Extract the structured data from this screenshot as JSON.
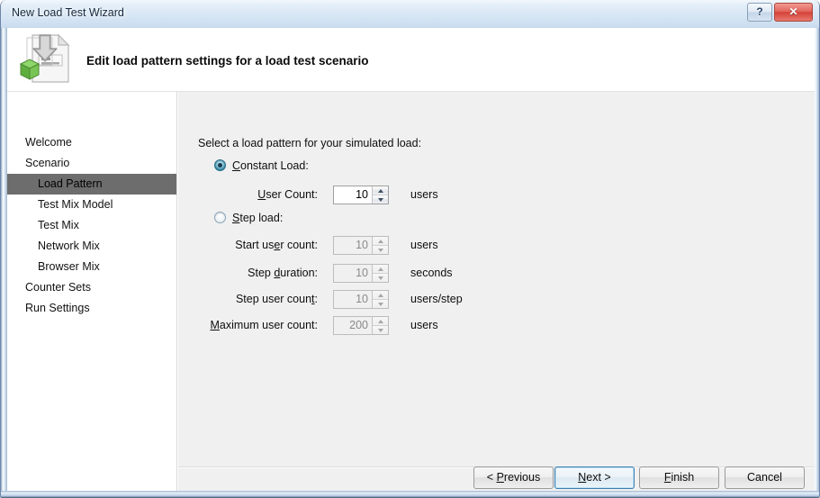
{
  "window": {
    "title": "New Load Test Wizard",
    "help_label": "?",
    "close_label": "✕"
  },
  "banner": {
    "icon": "load-test-document-icon",
    "title": "Edit load pattern settings for a load test scenario"
  },
  "sidebar": {
    "items": [
      {
        "label": "Welcome",
        "level": 0,
        "selected": false
      },
      {
        "label": "Scenario",
        "level": 0,
        "selected": false
      },
      {
        "label": "Load Pattern",
        "level": 1,
        "selected": true
      },
      {
        "label": "Test Mix Model",
        "level": 1,
        "selected": false
      },
      {
        "label": "Test Mix",
        "level": 1,
        "selected": false
      },
      {
        "label": "Network Mix",
        "level": 1,
        "selected": false
      },
      {
        "label": "Browser Mix",
        "level": 1,
        "selected": false
      },
      {
        "label": "Counter Sets",
        "level": 0,
        "selected": false
      },
      {
        "label": "Run Settings",
        "level": 0,
        "selected": false
      }
    ]
  },
  "main": {
    "prompt": "Select a load pattern for your simulated load:",
    "options": [
      {
        "id": "constant-load",
        "label_pre": "",
        "accel": "C",
        "label_post": "onstant Load:",
        "checked": true
      },
      {
        "id": "step-load",
        "label_pre": "",
        "accel": "S",
        "label_post": "tep load:",
        "checked": false
      }
    ],
    "fields": [
      {
        "id": "user-count",
        "label_pre": "",
        "accel": "U",
        "label_post": "ser Count:",
        "value": "10",
        "unit": "users",
        "disabled": false
      },
      {
        "id": "start-user-count",
        "label_pre": "Start us",
        "accel": "e",
        "label_post": "r count:",
        "value": "10",
        "unit": "users",
        "disabled": true
      },
      {
        "id": "step-duration",
        "label_pre": "Step ",
        "accel": "d",
        "label_post": "uration:",
        "value": "10",
        "unit": "seconds",
        "disabled": true
      },
      {
        "id": "step-user-count",
        "label_pre": "Step user coun",
        "accel": "t",
        "label_post": ":",
        "value": "10",
        "unit": "users/step",
        "disabled": true
      },
      {
        "id": "maximum-user-count",
        "label_pre": "",
        "accel": "M",
        "label_post": "aximum user count:",
        "value": "200",
        "unit": "users",
        "disabled": true
      }
    ]
  },
  "buttons": [
    {
      "id": "previous",
      "label_pre": "< ",
      "accel": "P",
      "label_post": "revious",
      "default": false
    },
    {
      "id": "next",
      "label_pre": "",
      "accel": "N",
      "label_post": "ext >",
      "default": true
    },
    {
      "id": "finish",
      "label_pre": "",
      "accel": "F",
      "label_post": "inish",
      "default": false
    },
    {
      "id": "cancel",
      "label_pre": "Cancel",
      "accel": "",
      "label_post": "",
      "default": false
    }
  ],
  "colors": {
    "selection": "#6d6d6d",
    "accent": "#3c7fb1",
    "close": "#d5433a",
    "panel": "#f0f0f0"
  }
}
